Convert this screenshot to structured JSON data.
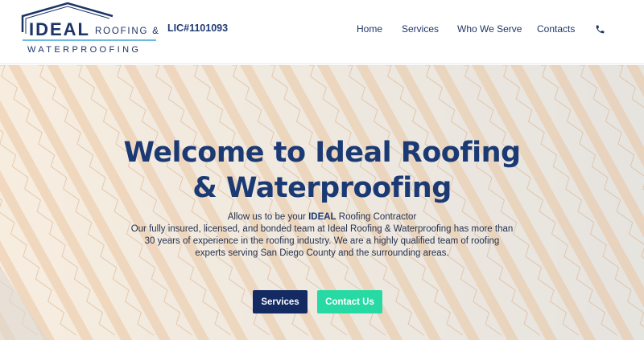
{
  "logo": {
    "main": "IDEAL",
    "sub1": "ROOFING &",
    "sub2": "WATERPROOFING"
  },
  "license": "LIC#1101093",
  "nav": {
    "home": "Home",
    "services": "Services",
    "who_we_serve": "Who We Serve",
    "contacts": "Contacts",
    "phone_icon": "phone-icon"
  },
  "hero": {
    "title_line1": "Welcome to Ideal Roofing",
    "title_line2": "& Waterproofing",
    "lead_prefix": "Allow us to be your ",
    "lead_bold": "IDEAL",
    "lead_suffix": " Roofing Contractor",
    "body_line1": "Our fully insured, licensed, and bonded team at Ideal Roofing & Waterproofing has more than",
    "body_line2": "30 years of experience in the roofing industry. We are a highly qualified team of roofing",
    "body_line3": "experts serving San Diego County and the surrounding areas.",
    "button_services": "Services",
    "button_contact": "Contact Us"
  },
  "colors": {
    "brand_navy": "#1c3466",
    "button_navy": "#142a63",
    "button_green": "#27d9a3",
    "tile_orange": "#d99a5a"
  }
}
